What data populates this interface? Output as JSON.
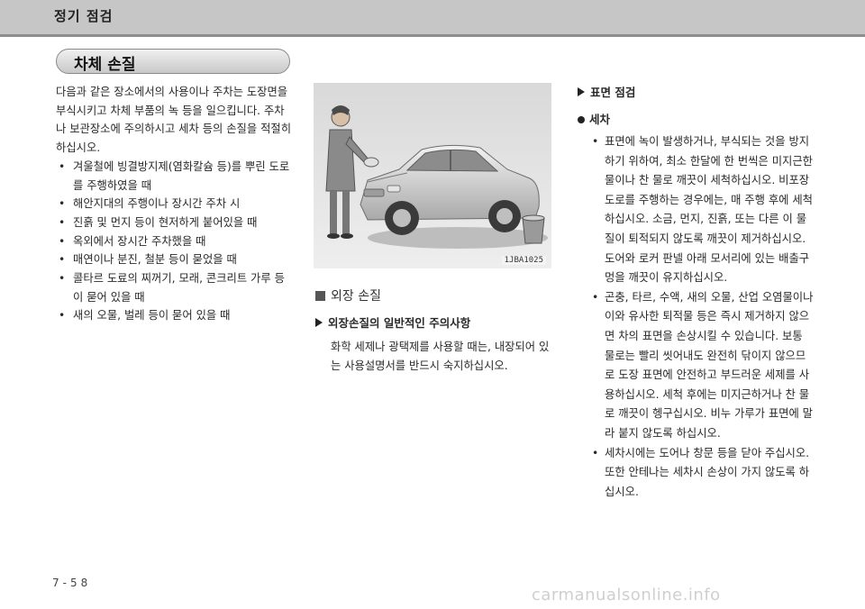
{
  "header": {
    "title": "정기 점검"
  },
  "section": {
    "title": "차체 손질"
  },
  "intro": "다음과 같은 장소에서의 사용이나 주차는 도장면을 부식시키고 차체 부품의 녹 등을 일으킵니다. 주차나 보관장소에 주의하시고 세차 등의 손질을 적절히 하십시오.",
  "conditions": [
    "겨울철에 빙결방지제(염화칼슘 등)를 뿌린 도로를 주행하였을 때",
    "해안지대의 주행이나 장시간 주차 시",
    "진흙 및 먼지 등이 현저하게 붙어있을 때",
    "옥외에서 장시간 주차했을 때",
    "매연이나 분진, 철분 등이 묻었을 때",
    "콜타르 도료의 찌꺼기, 모래, 콘크리트 가루 등이 묻어 있을 때",
    "새의 오물, 벌레 등이 묻어 있을 때"
  ],
  "image": {
    "code": "1JBA1025"
  },
  "exterior": {
    "heading": "외장 손질",
    "caution_title": "외장손질의 일반적인 주의사항",
    "caution_text": "화학 세제나 광택제를 사용할 때는, 내장되어 있는 사용설명서를 반드시 숙지하십시오."
  },
  "surface": {
    "heading": "표면 점검",
    "subheading": "세차",
    "items": [
      {
        "text": "표면에 녹이 발생하거나, 부식되는 것을 방지하기 위하여, 최소 한달에 한 번씩은 미지근한 물이나 찬 물로 깨끗이 세척하십시오. 비포장 도로를 주행하는 경우에는, 매 주행 후에 세척하십시오. 소금, 먼지, 진흙, 또는 다른 이 물질이 퇴적되지 않도록 깨끗이 제거하십시오.",
        "extra": "도어와 로커 판넬 아래 모서리에 있는 배출구멍을 깨끗이 유지하십시오."
      },
      {
        "text": "곤충, 타르, 수액, 새의 오물, 산업 오염물이나 이와 유사한 퇴적물 등은 즉시 제거하지 않으면 차의 표면을 손상시킬 수 있습니다. 보통 물로는 빨리 씻어내도 완전히 닦이지 않으므로 도장 표면에 안전하고 부드러운 세제를 사용하십시오. 세척 후에는 미지근하거나 찬 물로 깨끗이 헹구십시오. 비누 가루가 표면에 말라 붙지 않도록 하십시오."
      },
      {
        "text": "세차시에는 도어나 창문 등을 닫아 주십시오. 또한 안테나는 세차시 손상이 가지 않도록 하십시오."
      }
    ]
  },
  "footer": {
    "page": "7-58",
    "watermark": "carmanualsonline.info"
  }
}
